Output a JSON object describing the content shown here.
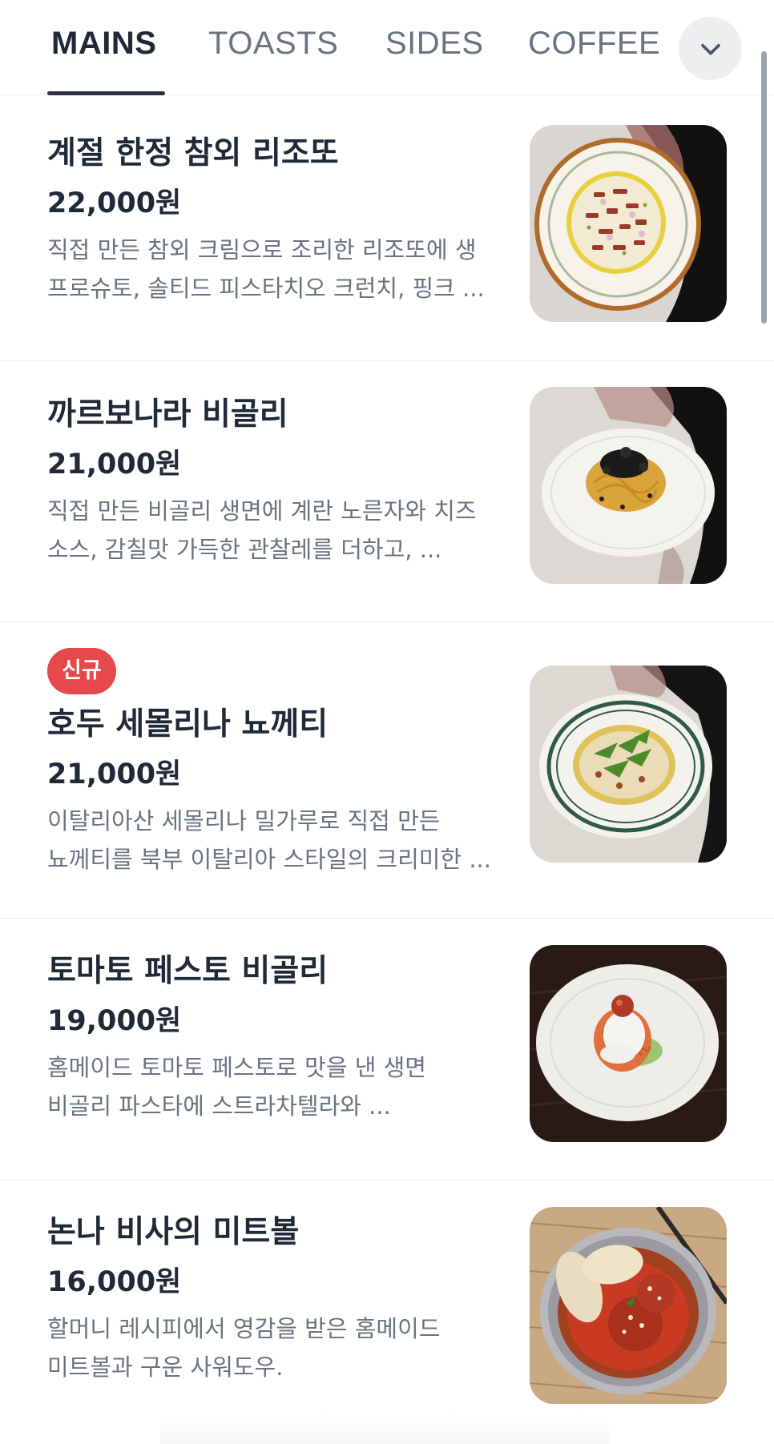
{
  "tabs": [
    {
      "label": "MAINS",
      "active": true
    },
    {
      "label": "TOASTS",
      "active": false
    },
    {
      "label": "SIDES",
      "active": false
    },
    {
      "label": "COFFEE",
      "active": false
    }
  ],
  "more_icon": "chevron-down-icon",
  "colors": {
    "badge_new": "#e5484d",
    "active_tab": "#1f2937",
    "inactive_tab": "#6b7280"
  },
  "menu_items": [
    {
      "name": "계절 한정 참외 리조또",
      "price": "22,000원",
      "desc_line1": "직접 만든 참외 크림으로 조리한 리조또에 생",
      "desc_line2": "프로슈토, 솔티드 피스타치오 크런치, 핑크 ...",
      "badge": ""
    },
    {
      "name": "까르보나라 비골리",
      "price": "21,000원",
      "desc_line1": "직접 만든 비골리 생면에 계란 노른자와 치즈",
      "desc_line2": "소스, 감칠맛 가득한 관찰레를 더하고, ...",
      "badge": ""
    },
    {
      "name": "호두 세몰리나 뇨께티",
      "price": "21,000원",
      "desc_line1": "이탈리아산 세몰리나 밀가루로 직접 만든",
      "desc_line2": "뇨께티를 북부 이탈리아 스타일의 크리미한 ...",
      "badge": "신규"
    },
    {
      "name": "토마토 페스토 비골리",
      "price": "19,000원",
      "desc_line1": "홈메이드 토마토 페스토로 맛을 낸 생면",
      "desc_line2": "비골리 파스타에 스트라차텔라와 ...",
      "badge": ""
    },
    {
      "name": "논나 비사의 미트볼",
      "price": "16,000원",
      "desc_line1": "할머니 레시피에서 영감을 받은 홈메이드",
      "desc_line2": "미트볼과 구운 사워도우.",
      "badge": ""
    }
  ]
}
